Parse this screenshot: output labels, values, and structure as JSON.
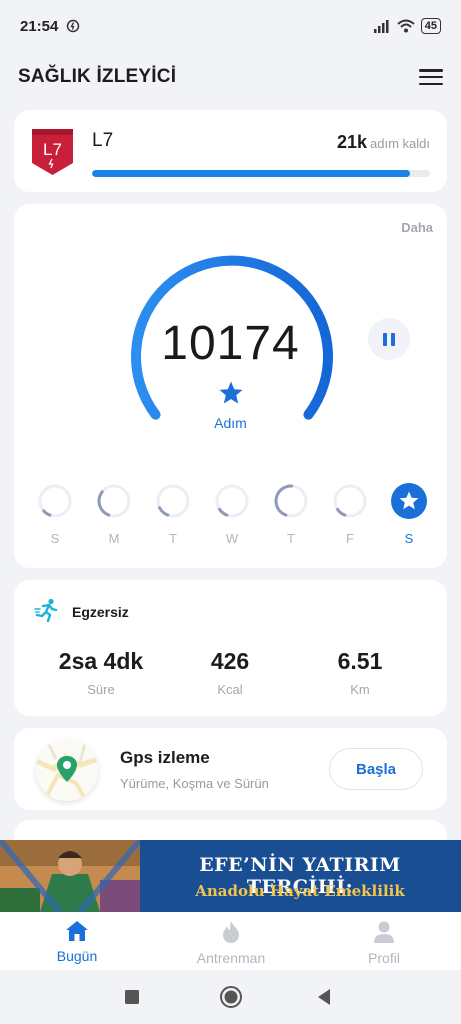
{
  "status_bar": {
    "time": "21:54",
    "battery": "45"
  },
  "header": {
    "title": "SAĞLIK İZLEYİCİ"
  },
  "level": {
    "badge_text": "L7",
    "name": "L7",
    "remaining_value": "21k",
    "remaining_unit": "adım kaldı",
    "progress": 0.94
  },
  "steps": {
    "more_label": "Daha",
    "count": "10174",
    "label": "Adım",
    "days": [
      {
        "label": "S",
        "progress": 0.08
      },
      {
        "label": "M",
        "progress": 0.3
      },
      {
        "label": "T",
        "progress": 0.12
      },
      {
        "label": "W",
        "progress": 0.1
      },
      {
        "label": "T",
        "progress": 0.45
      },
      {
        "label": "F",
        "progress": 0.1
      },
      {
        "label": "S",
        "progress": 1.0,
        "active": true
      }
    ]
  },
  "exercise": {
    "title": "Egzersiz",
    "stats": [
      {
        "value": "2sa 4dk",
        "label": "Süre"
      },
      {
        "value": "426",
        "label": "Kcal"
      },
      {
        "value": "6.51",
        "label": "Km"
      }
    ]
  },
  "gps": {
    "title": "Gps izleme",
    "subtitle": "Yürüme, Koşma ve Sürün",
    "button": "Başla"
  },
  "ad": {
    "line1": "EFE’NİN YATIRIM TERCİHİ:",
    "line2": "Anadolu Hayat Emeklilik"
  },
  "nav": {
    "items": [
      {
        "label": "Bugün",
        "icon": "home-icon",
        "active": true
      },
      {
        "label": "Antrenman",
        "icon": "flame-icon"
      },
      {
        "label": "Profil",
        "icon": "person-icon"
      }
    ]
  },
  "colors": {
    "accent": "#1b6fd9",
    "progress": "#1b82e8",
    "badge": "#c8203a"
  }
}
